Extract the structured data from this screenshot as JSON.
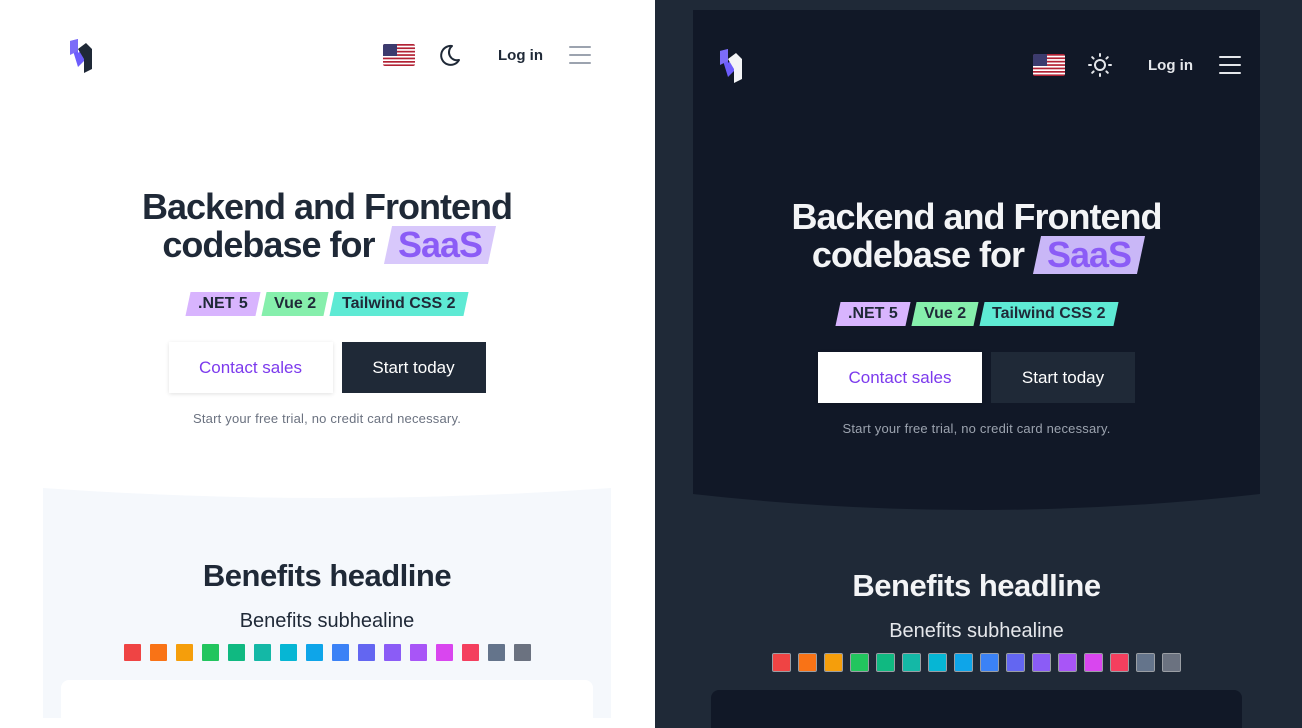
{
  "header": {
    "login_label": "Log in",
    "flag_icon": "us-flag-icon"
  },
  "hero": {
    "title_line1": "Backend and Frontend",
    "title_line2": "codebase for",
    "title_highlight": "SaaS",
    "tags": [
      {
        "label": ".NET 5",
        "color": "#d8b4fe"
      },
      {
        "label": "Vue 2",
        "color": "#86efac"
      },
      {
        "label": "Tailwind CSS 2",
        "color": "#5eead4"
      }
    ],
    "contact_sales_label": "Contact sales",
    "start_today_label": "Start today",
    "trial_note": "Start your free trial, no credit card necessary."
  },
  "benefits": {
    "headline": "Benefits headline",
    "subheadline": "Benefits subhealine",
    "palette": [
      "#ef4444",
      "#f97316",
      "#f59e0b",
      "#22c55e",
      "#10b981",
      "#14b8a6",
      "#06b6d4",
      "#0ea5e9",
      "#3b82f6",
      "#6366f1",
      "#8b5cf6",
      "#a855f7",
      "#d946ef",
      "#f43f5e",
      "#64748b",
      "#6b7280"
    ]
  },
  "themes": {
    "light": {
      "mode_icon": "moon-icon",
      "section_bg": "#f5f8fc"
    },
    "dark": {
      "mode_icon": "sun-icon",
      "section_bg": "#1f2937"
    }
  }
}
